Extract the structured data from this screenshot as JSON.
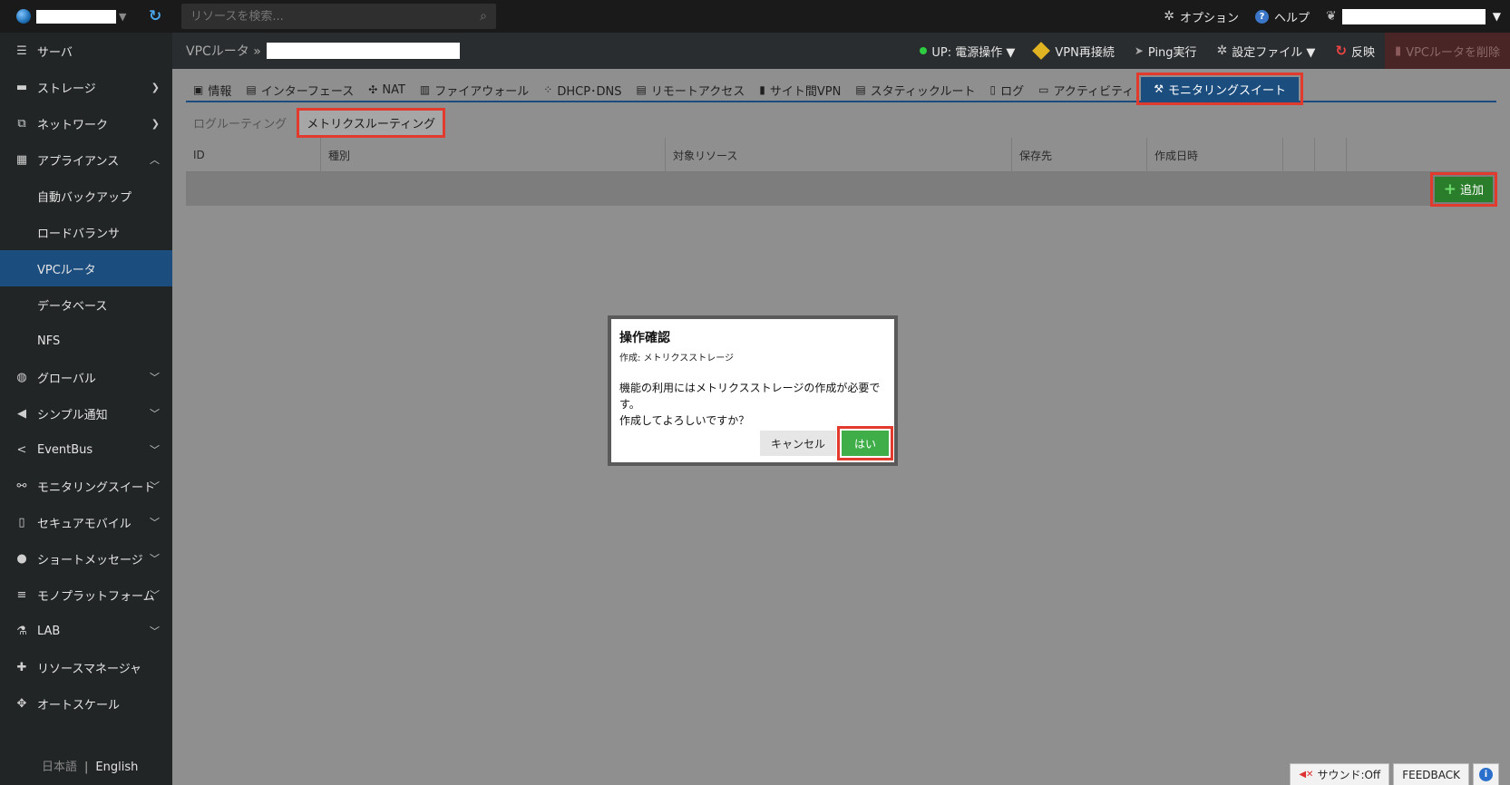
{
  "topbar": {
    "search_placeholder": "リソースを検索...",
    "options_label": "オプション",
    "help_label": "ヘルプ"
  },
  "sidebar": {
    "items": [
      {
        "label": "サーバ",
        "icon": "server-icon",
        "has_chevron": false
      },
      {
        "label": "ストレージ",
        "icon": "storage-icon",
        "has_chevron": true
      },
      {
        "label": "ネットワーク",
        "icon": "network-icon",
        "has_chevron": true
      },
      {
        "label": "アプライアンス",
        "icon": "appliance-icon",
        "has_chevron": true,
        "expanded": true
      }
    ],
    "appliance_sub": [
      {
        "label": "自動バックアップ",
        "active": false
      },
      {
        "label": "ロードバランサ",
        "active": false
      },
      {
        "label": "VPCルータ",
        "active": true
      },
      {
        "label": "データベース",
        "active": false
      },
      {
        "label": "NFS",
        "active": false
      }
    ],
    "items2": [
      {
        "label": "グローバル",
        "icon": "globe-icon",
        "has_chevron": true
      },
      {
        "label": "シンプル通知",
        "icon": "megaphone-icon",
        "has_chevron": true
      },
      {
        "label": "EventBus",
        "icon": "share-icon",
        "has_chevron": true
      },
      {
        "label": "モニタリングスイート",
        "icon": "binoculars-icon",
        "has_chevron": true
      },
      {
        "label": "セキュアモバイル",
        "icon": "mobile-icon",
        "has_chevron": true
      },
      {
        "label": "ショートメッセージ",
        "icon": "chat-icon",
        "has_chevron": true
      },
      {
        "label": "モノプラットフォーム",
        "icon": "layers-icon",
        "has_chevron": true
      },
      {
        "label": "LAB",
        "icon": "flask-icon",
        "has_chevron": true
      },
      {
        "label": "リソースマネージャ",
        "icon": "puzzle-icon",
        "has_chevron": false
      },
      {
        "label": "オートスケール",
        "icon": "move-icon",
        "has_chevron": false
      }
    ],
    "lang_ja": "日本語",
    "lang_en": "English"
  },
  "header": {
    "breadcrumb": "VPCルータ »",
    "actions": {
      "power": "UP: 電源操作 ▼",
      "vpn_reconnect": "VPN再接続",
      "ping": "Ping実行",
      "config_file": "設定ファイル ▼",
      "apply": "反映",
      "delete": "VPCルータを削除"
    }
  },
  "tabs": [
    {
      "label": "情報",
      "icon": "info-icon"
    },
    {
      "label": "インターフェース",
      "icon": "interface-icon"
    },
    {
      "label": "NAT",
      "icon": "nat-icon"
    },
    {
      "label": "ファイアウォール",
      "icon": "firewall-icon"
    },
    {
      "label": "DHCP･DNS",
      "icon": "dhcp-icon"
    },
    {
      "label": "リモートアクセス",
      "icon": "remote-access-icon"
    },
    {
      "label": "サイト間VPN",
      "icon": "site-vpn-icon"
    },
    {
      "label": "スタティックルート",
      "icon": "static-route-icon"
    },
    {
      "label": "ログ",
      "icon": "log-icon"
    },
    {
      "label": "アクティビティ",
      "icon": "activity-icon"
    },
    {
      "label": "モニタリングスイート",
      "icon": "wrench-icon",
      "active": true
    }
  ],
  "subtabs": [
    {
      "label": "ログルーティング",
      "active": false
    },
    {
      "label": "メトリクスルーティング",
      "active": true
    }
  ],
  "table": {
    "columns": [
      "ID",
      "種別",
      "対象リソース",
      "保存先",
      "作成日時",
      "",
      ""
    ]
  },
  "add_button": "追加",
  "dialog": {
    "title": "操作確認",
    "subtitle": "作成: メトリクスストレージ",
    "message_line1": "機能の利用にはメトリクスストレージの作成が必要です。",
    "message_line2": "作成してよろしいですか？",
    "cancel": "キャンセル",
    "yes": "はい"
  },
  "footer": {
    "sound": "サウンド:Off",
    "feedback": "FEEDBACK"
  },
  "colors": {
    "accent": "#1b4d7e",
    "highlight": "#e23a2c",
    "confirm": "#3fae49"
  }
}
